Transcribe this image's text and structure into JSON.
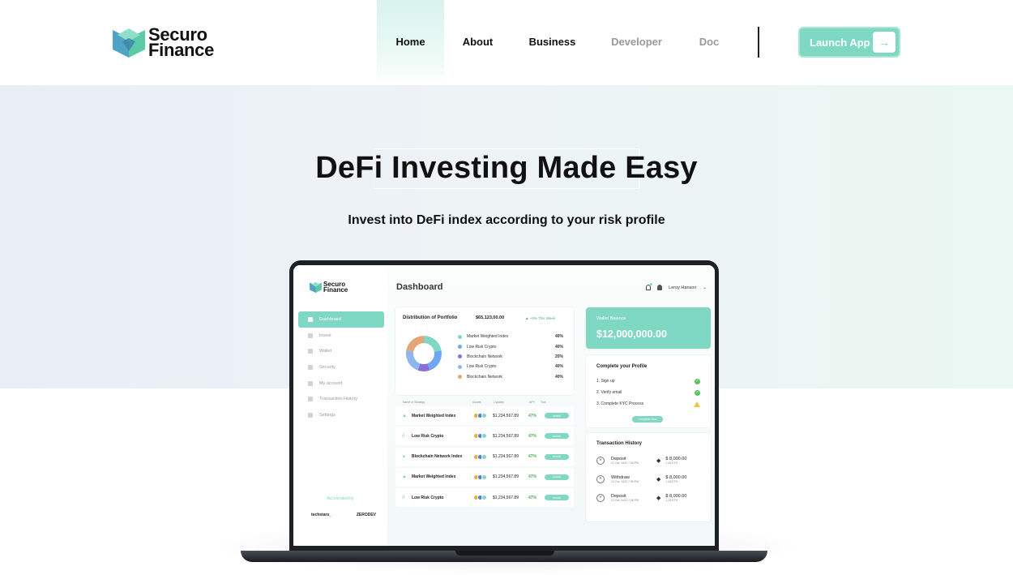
{
  "brand": {
    "line1": "Securo",
    "line2": "Finance"
  },
  "nav": {
    "items": [
      {
        "label": "Home"
      },
      {
        "label": "About"
      },
      {
        "label": "Business"
      },
      {
        "label": "Developer"
      },
      {
        "label": "Doc"
      }
    ],
    "launch_label": "Launch App",
    "launch_arrow": "→"
  },
  "hero": {
    "title": "DeFi Investing Made Easy",
    "subtitle": "Invest into DeFi index according to your risk profile"
  },
  "dashboard": {
    "brand": {
      "line1": "Securo",
      "line2": "Finance"
    },
    "title": "Dashboard",
    "user_name": "Leroy Hanson",
    "menu": [
      {
        "label": "Dashboard"
      },
      {
        "label": "Invest"
      },
      {
        "label": "Wallet"
      },
      {
        "label": "Security"
      },
      {
        "label": "My account"
      },
      {
        "label": "Transaction History"
      },
      {
        "label": "Settings"
      }
    ],
    "accelerated_by": "Accelerated by",
    "partners": [
      "techstars_",
      "ZERODEV"
    ],
    "portfolio": {
      "title": "Distribution of Portfolio",
      "amount": "$65,123,00.00",
      "change": "▲ +5% This Week",
      "legend": [
        {
          "name": "Market Weighted Index",
          "pct": "40%",
          "color": "#7fd8c3"
        },
        {
          "name": "Low Risk Crypto",
          "pct": "40%",
          "color": "#6fa8f0"
        },
        {
          "name": "Blockchain Network",
          "pct": "20%",
          "color": "#8b6fd8"
        },
        {
          "name": "Low Risk Crypto",
          "pct": "40%",
          "color": "#8fb7ef"
        },
        {
          "name": "Blockchain Network",
          "pct": "40%",
          "color": "#e5a574"
        }
      ],
      "donut": [
        40,
        40,
        20,
        40,
        40
      ]
    },
    "strategy_header": [
      "Name of Strategy",
      "Assets",
      "Liquidity",
      "APY",
      "Tool"
    ],
    "strategies": [
      {
        "name": "Market Weighted Index",
        "liquidity": "$1,234,567.89",
        "apy": "47%",
        "action": "Invest"
      },
      {
        "name": "Low Risk Crypto",
        "liquidity": "$1,234,567.89",
        "apy": "47%",
        "action": "Invest"
      },
      {
        "name": "Blockchain Network Index",
        "liquidity": "$1,234,567.89",
        "apy": "47%",
        "action": "Invest"
      },
      {
        "name": "Market Weighted Index",
        "liquidity": "$1,234,567.89",
        "apy": "47%",
        "action": "Invest"
      },
      {
        "name": "Low Risk Crypto",
        "liquidity": "$1,234,567.89",
        "apy": "47%",
        "action": "Invest"
      }
    ],
    "wallet": {
      "label": "Wallet Balance",
      "value": "$12,000,000.00"
    },
    "profile": {
      "title": "Complete your Profile",
      "steps": [
        "1. Sign up",
        "2. Verify email",
        "3. Complete KYC Process"
      ],
      "button": "Complete Now"
    },
    "transactions": {
      "title": "Transaction History",
      "rows": [
        {
          "type": "Deposit",
          "date": "12 Oct. 2022 7:36 PM",
          "amount": "$ 8,000.00",
          "eth": "1.28 ETH",
          "dir": "down"
        },
        {
          "type": "Withdraw",
          "date": "12 Oct. 2022 7:36 PM",
          "amount": "$ 8,000.00",
          "eth": "1.28 ETH",
          "dir": "up"
        },
        {
          "type": "Deposit",
          "date": "12 Oct. 2022 7:36 PM",
          "amount": "$ 8,000.00",
          "eth": "1.28 ETH",
          "dir": "down"
        }
      ]
    }
  }
}
